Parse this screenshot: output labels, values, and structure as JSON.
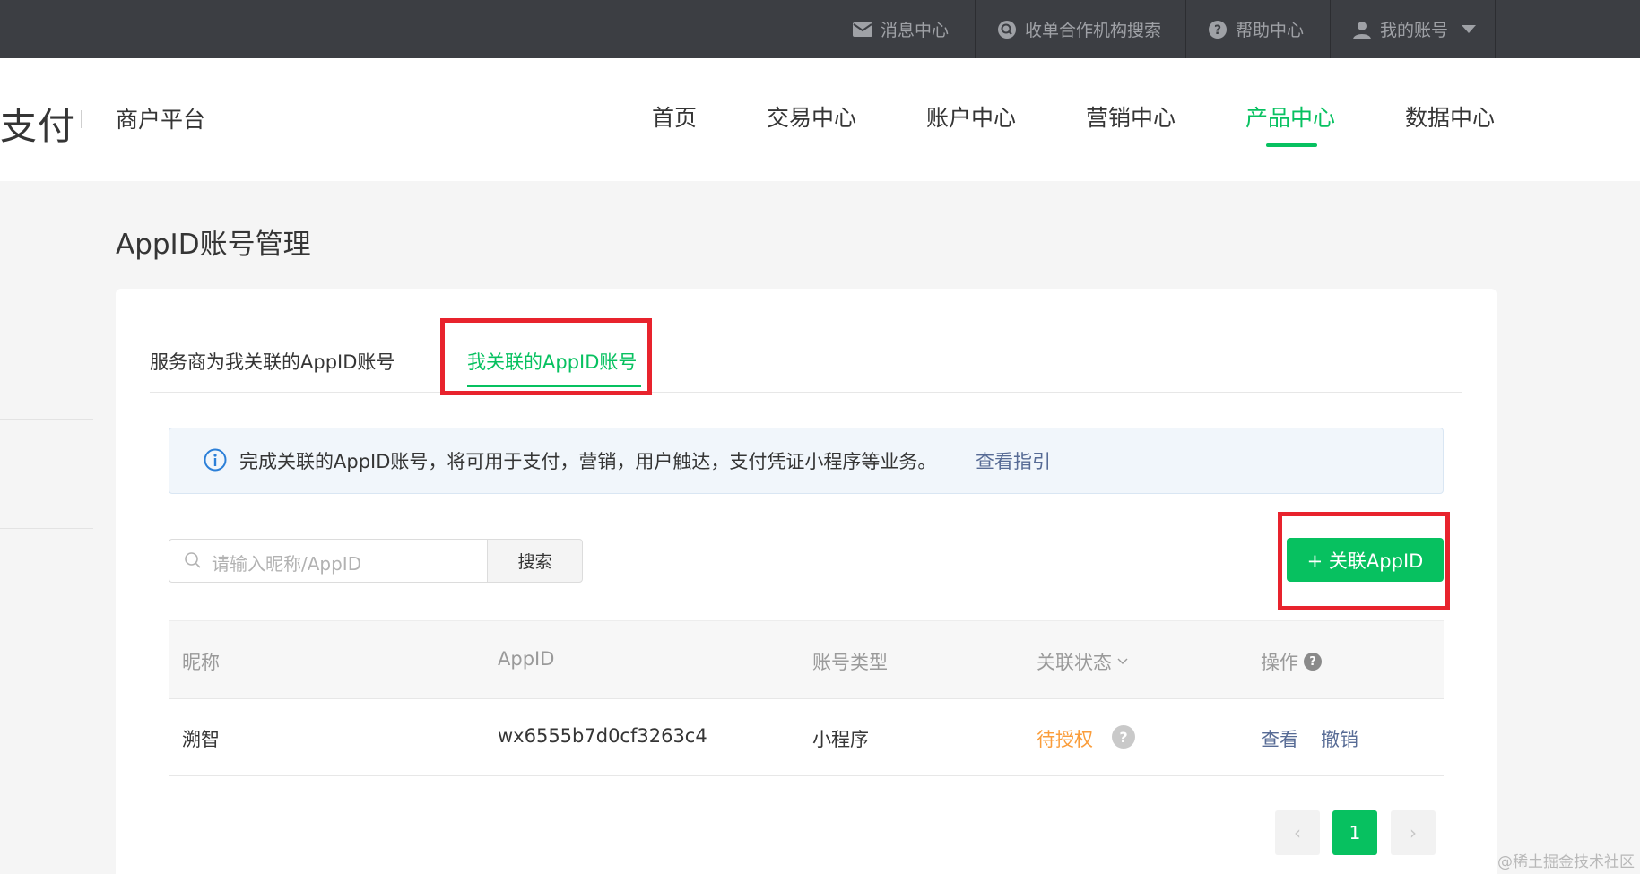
{
  "topbar": {
    "items": [
      {
        "label": "消息中心",
        "icon": "mail-icon"
      },
      {
        "label": "收单合作机构搜索",
        "icon": "search-circle-icon"
      },
      {
        "label": "帮助中心",
        "icon": "help-icon"
      },
      {
        "label": "我的账号",
        "icon": "user-icon"
      }
    ]
  },
  "header": {
    "brand_fragment": "支付",
    "brand_subtitle": "商户平台",
    "nav": [
      "首页",
      "交易中心",
      "账户中心",
      "营销中心",
      "产品中心",
      "数据中心"
    ],
    "active_nav": "产品中心"
  },
  "page": {
    "title": "AppID账号管理"
  },
  "tabs": {
    "items": [
      "服务商为我关联的AppID账号",
      "我关联的AppID账号"
    ],
    "active": "我关联的AppID账号"
  },
  "info": {
    "text": "完成关联的AppID账号，将可用于支付，营销，用户触达，支付凭证小程序等业务。",
    "link": "查看指引"
  },
  "search": {
    "placeholder": "请输入昵称/AppID",
    "button": "搜索"
  },
  "add_button": "+ 关联AppID",
  "table": {
    "headers": [
      "昵称",
      "AppID",
      "账号类型",
      "关联状态",
      "操作"
    ],
    "rows": [
      {
        "nickname": "溯智",
        "appid": "wx6555b7d0cf3263c4",
        "type": "小程序",
        "status": "待授权",
        "actions": [
          "查看",
          "撤销"
        ]
      }
    ]
  },
  "pagination": {
    "current": "1",
    "prev": "‹",
    "next": "›"
  },
  "watermark": "@稀土掘金技术社区",
  "colors": {
    "accent": "#07c160",
    "link": "#576b95",
    "warning": "#fa9d3b",
    "highlight": "#e8232d"
  }
}
